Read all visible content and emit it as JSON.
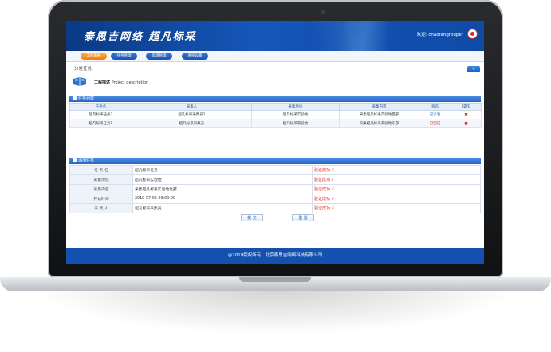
{
  "header": {
    "logo": "泰思吉网络 超凡标采",
    "welcome_label": "欢迎:",
    "username": "chaofangrouper"
  },
  "nav": {
    "tabs": [
      {
        "label": "工作简报",
        "active": true
      },
      {
        "label": "任务管理",
        "active": false
      },
      {
        "label": "资源管理",
        "active": false
      },
      {
        "label": "系统设置",
        "active": false
      }
    ]
  },
  "breadcrumb": "分发任务:",
  "back_button": "«",
  "project": {
    "title": "工程描述",
    "subtitle": "Project description"
  },
  "task_list": {
    "section_title": "任务列表",
    "columns": [
      "任务名",
      "采集人",
      "采集地址",
      "采集内容",
      "状态",
      "操作"
    ],
    "rows": [
      {
        "name": "超凡标采任务2",
        "collector": "超凡标采采集员1",
        "address": "超凡标采实验地",
        "content": "采集超凡标采实验地西部",
        "status": "已派发",
        "status_color": "#1f63c6"
      },
      {
        "name": "超凡标采任务1",
        "collector": "超凡标采采集员",
        "address": "超凡标采实验地",
        "content": "采集超凡标采实验地东部",
        "status": "已完成",
        "status_color": "#d21a1a"
      }
    ]
  },
  "add_task": {
    "section_title": "添加任务",
    "fields": [
      {
        "label": "任 务 名",
        "value": "超凡标采任务",
        "check": "验证成功 √"
      },
      {
        "label": "采集地址",
        "value": "超凡标采实验地",
        "check": "验证成功 √"
      },
      {
        "label": "采集内容",
        "value": "采集超凡标采实验地北部",
        "check": "验证成功 √"
      },
      {
        "label": "开始时间",
        "value": "2019-07-05 09:00:00",
        "check": "验证成功 √"
      },
      {
        "label": "采 集 人",
        "value": "超凡标采采集员",
        "check": "验证成功 √"
      }
    ],
    "submit_label": "提 交",
    "reset_label": "重 置"
  },
  "footer": "@2019版权所有：北京泰思吉网络科技有限公司",
  "colors": {
    "header_blue": "#1556b8",
    "active_tab": "#f27b14",
    "success_red": "#e0201a",
    "footer_blue": "#1450ad"
  }
}
